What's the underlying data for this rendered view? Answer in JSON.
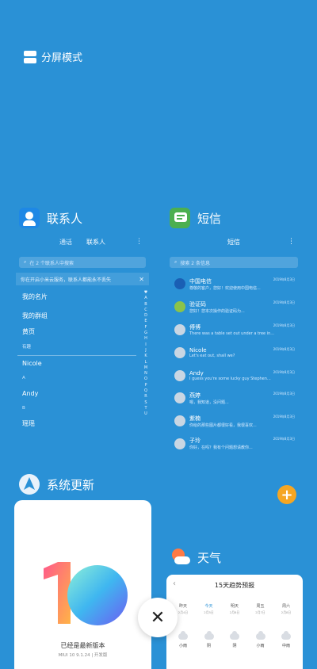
{
  "split_mode_label": "分屏模式",
  "contacts": {
    "title": "联系人",
    "tabs": [
      "通话",
      "联系人"
    ],
    "search_placeholder": "在 2 个联系人中搜索",
    "banner": "你在开启小米云服务，联系人都能永不丢失",
    "rows": [
      "我的名片",
      "我的群组",
      "黄页"
    ],
    "section": "有趣",
    "list": [
      {
        "type": "name",
        "text": "Nicole"
      },
      {
        "type": "letter",
        "text": "A"
      },
      {
        "type": "name",
        "text": "Andy"
      },
      {
        "type": "letter",
        "text": "B"
      },
      {
        "type": "name",
        "text": "瑶瑶"
      }
    ],
    "index_letters": [
      "♥",
      "A",
      "B",
      "C",
      "D",
      "E",
      "F",
      "G",
      "H",
      "I",
      "J",
      "K",
      "L",
      "M",
      "N",
      "O",
      "P",
      "Q",
      "R",
      "S",
      "T",
      "U"
    ]
  },
  "messages": {
    "title": "短信",
    "header": "短信",
    "search_placeholder": "搜索 2 条信息",
    "items": [
      {
        "name": "中国电信",
        "time": "2019年8月3日",
        "preview": "尊敬的客户，您好！欢迎使用中国电信...",
        "avatar": "#1a5fb4"
      },
      {
        "name": "验证码",
        "time": "2019年8月3日",
        "preview": "您好！您本次操作的验证码为...",
        "avatar": "#8bc34a"
      },
      {
        "name": "傅博",
        "time": "2019年8月3日",
        "preview": "There was a table set out under a tree in...",
        "avatar": "#c9d6e3"
      },
      {
        "name": "Nicole",
        "time": "2019年8月3日",
        "preview": "Let's eat out, shall we?",
        "avatar": "#c9d6e3"
      },
      {
        "name": "Andy",
        "time": "2019年8月3日",
        "preview": "I guess you're some lucky guy Stephen...",
        "avatar": "#c9d6e3"
      },
      {
        "name": "燕婷",
        "time": "2019年8月3日",
        "preview": "嗯，我知道，没问题...",
        "avatar": "#c9d6e3"
      },
      {
        "name": "紫楠",
        "time": "2019年8月3日",
        "preview": "你给的那些图片都很好看，我很喜欢...",
        "avatar": "#c9d6e3"
      },
      {
        "name": "子玲",
        "time": "2019年8月3日",
        "preview": "你好，在吗？我有个问题想请教你...",
        "avatar": "#c9d6e3"
      }
    ]
  },
  "update": {
    "title": "系统更新",
    "status": "已经是最新版本",
    "version": "MIUI 10 9.1.24 | 开发版"
  },
  "weather": {
    "title": "天气",
    "card_title": "15天趋势预报",
    "days": [
      {
        "name": "昨天",
        "date": "2月4日",
        "cond": "小雨"
      },
      {
        "name": "今天",
        "date": "2月5日",
        "cond": "阴"
      },
      {
        "name": "明天",
        "date": "2月6日",
        "cond": "阴"
      },
      {
        "name": "周五",
        "date": "2月7日",
        "cond": "小雨"
      },
      {
        "name": "周六",
        "date": "2月8日",
        "cond": "中雨"
      }
    ]
  },
  "colors": {
    "background": "#2a91d6",
    "accent_orange": "#f5a623"
  }
}
